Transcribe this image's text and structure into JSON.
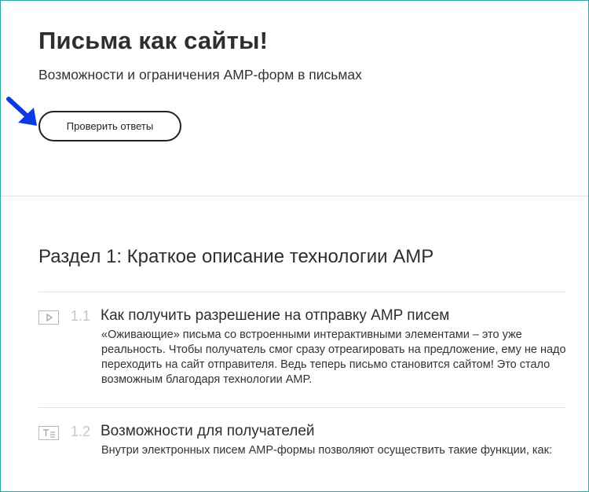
{
  "hero": {
    "title": "Письма как сайты!",
    "subtitle": "Возможности и ограничения AMP-форм в письмах",
    "check_button_label": "Проверить ответы",
    "accent_color": "#0a3ae0"
  },
  "section": {
    "title": "Раздел 1: Краткое описание технологии AMP"
  },
  "lessons": [
    {
      "icon": "play-icon",
      "number": "1.1",
      "title": "Как получить разрешение на отправку AMP писем",
      "description": "«Оживающие» письма со встроенными интерактивными элементами – это уже реальность. Чтобы получатель смог сразу отреагировать на предложение, ему не надо переходить на сайт отправителя. Ведь теперь письмо становится сайтом! Это стало возможным благодаря технологии AMP."
    },
    {
      "icon": "text-icon",
      "number": "1.2",
      "title": "Возможности для получателей",
      "description": "Внутри электронных писем AMP-формы позволяют осуществить такие функции, как:"
    }
  ]
}
